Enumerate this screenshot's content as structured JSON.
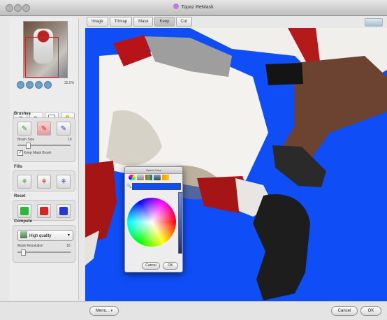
{
  "window": {
    "title": "Topaz ReMask"
  },
  "sidebar": {
    "zoom_label": "35.5%",
    "brushes": {
      "label": "Brushes",
      "size_label": "Brush Size",
      "size_value": "10",
      "size_fraction": 0.2,
      "checkbox_label": "Keep Mask Brush",
      "checkbox_checked": true
    },
    "fills": {
      "label": "Fills"
    },
    "reset": {
      "label": "Reset"
    },
    "compute": {
      "label": "Compute",
      "quality": "High quality",
      "detail_label": "Mask Resolution",
      "detail_value": "16",
      "detail_fraction": 0.1
    }
  },
  "tabs": [
    "Image",
    "Trimap",
    "Mask",
    "Keep",
    "Cut"
  ],
  "active_tab": 3,
  "picker": {
    "title": "Select Color",
    "cancel": "Cancel",
    "ok": "OK"
  },
  "bottom": {
    "menu": "Menu...",
    "cancel": "Cancel",
    "ok": "OK"
  },
  "colors": {
    "canvas_bg": "#0f4ef6"
  }
}
